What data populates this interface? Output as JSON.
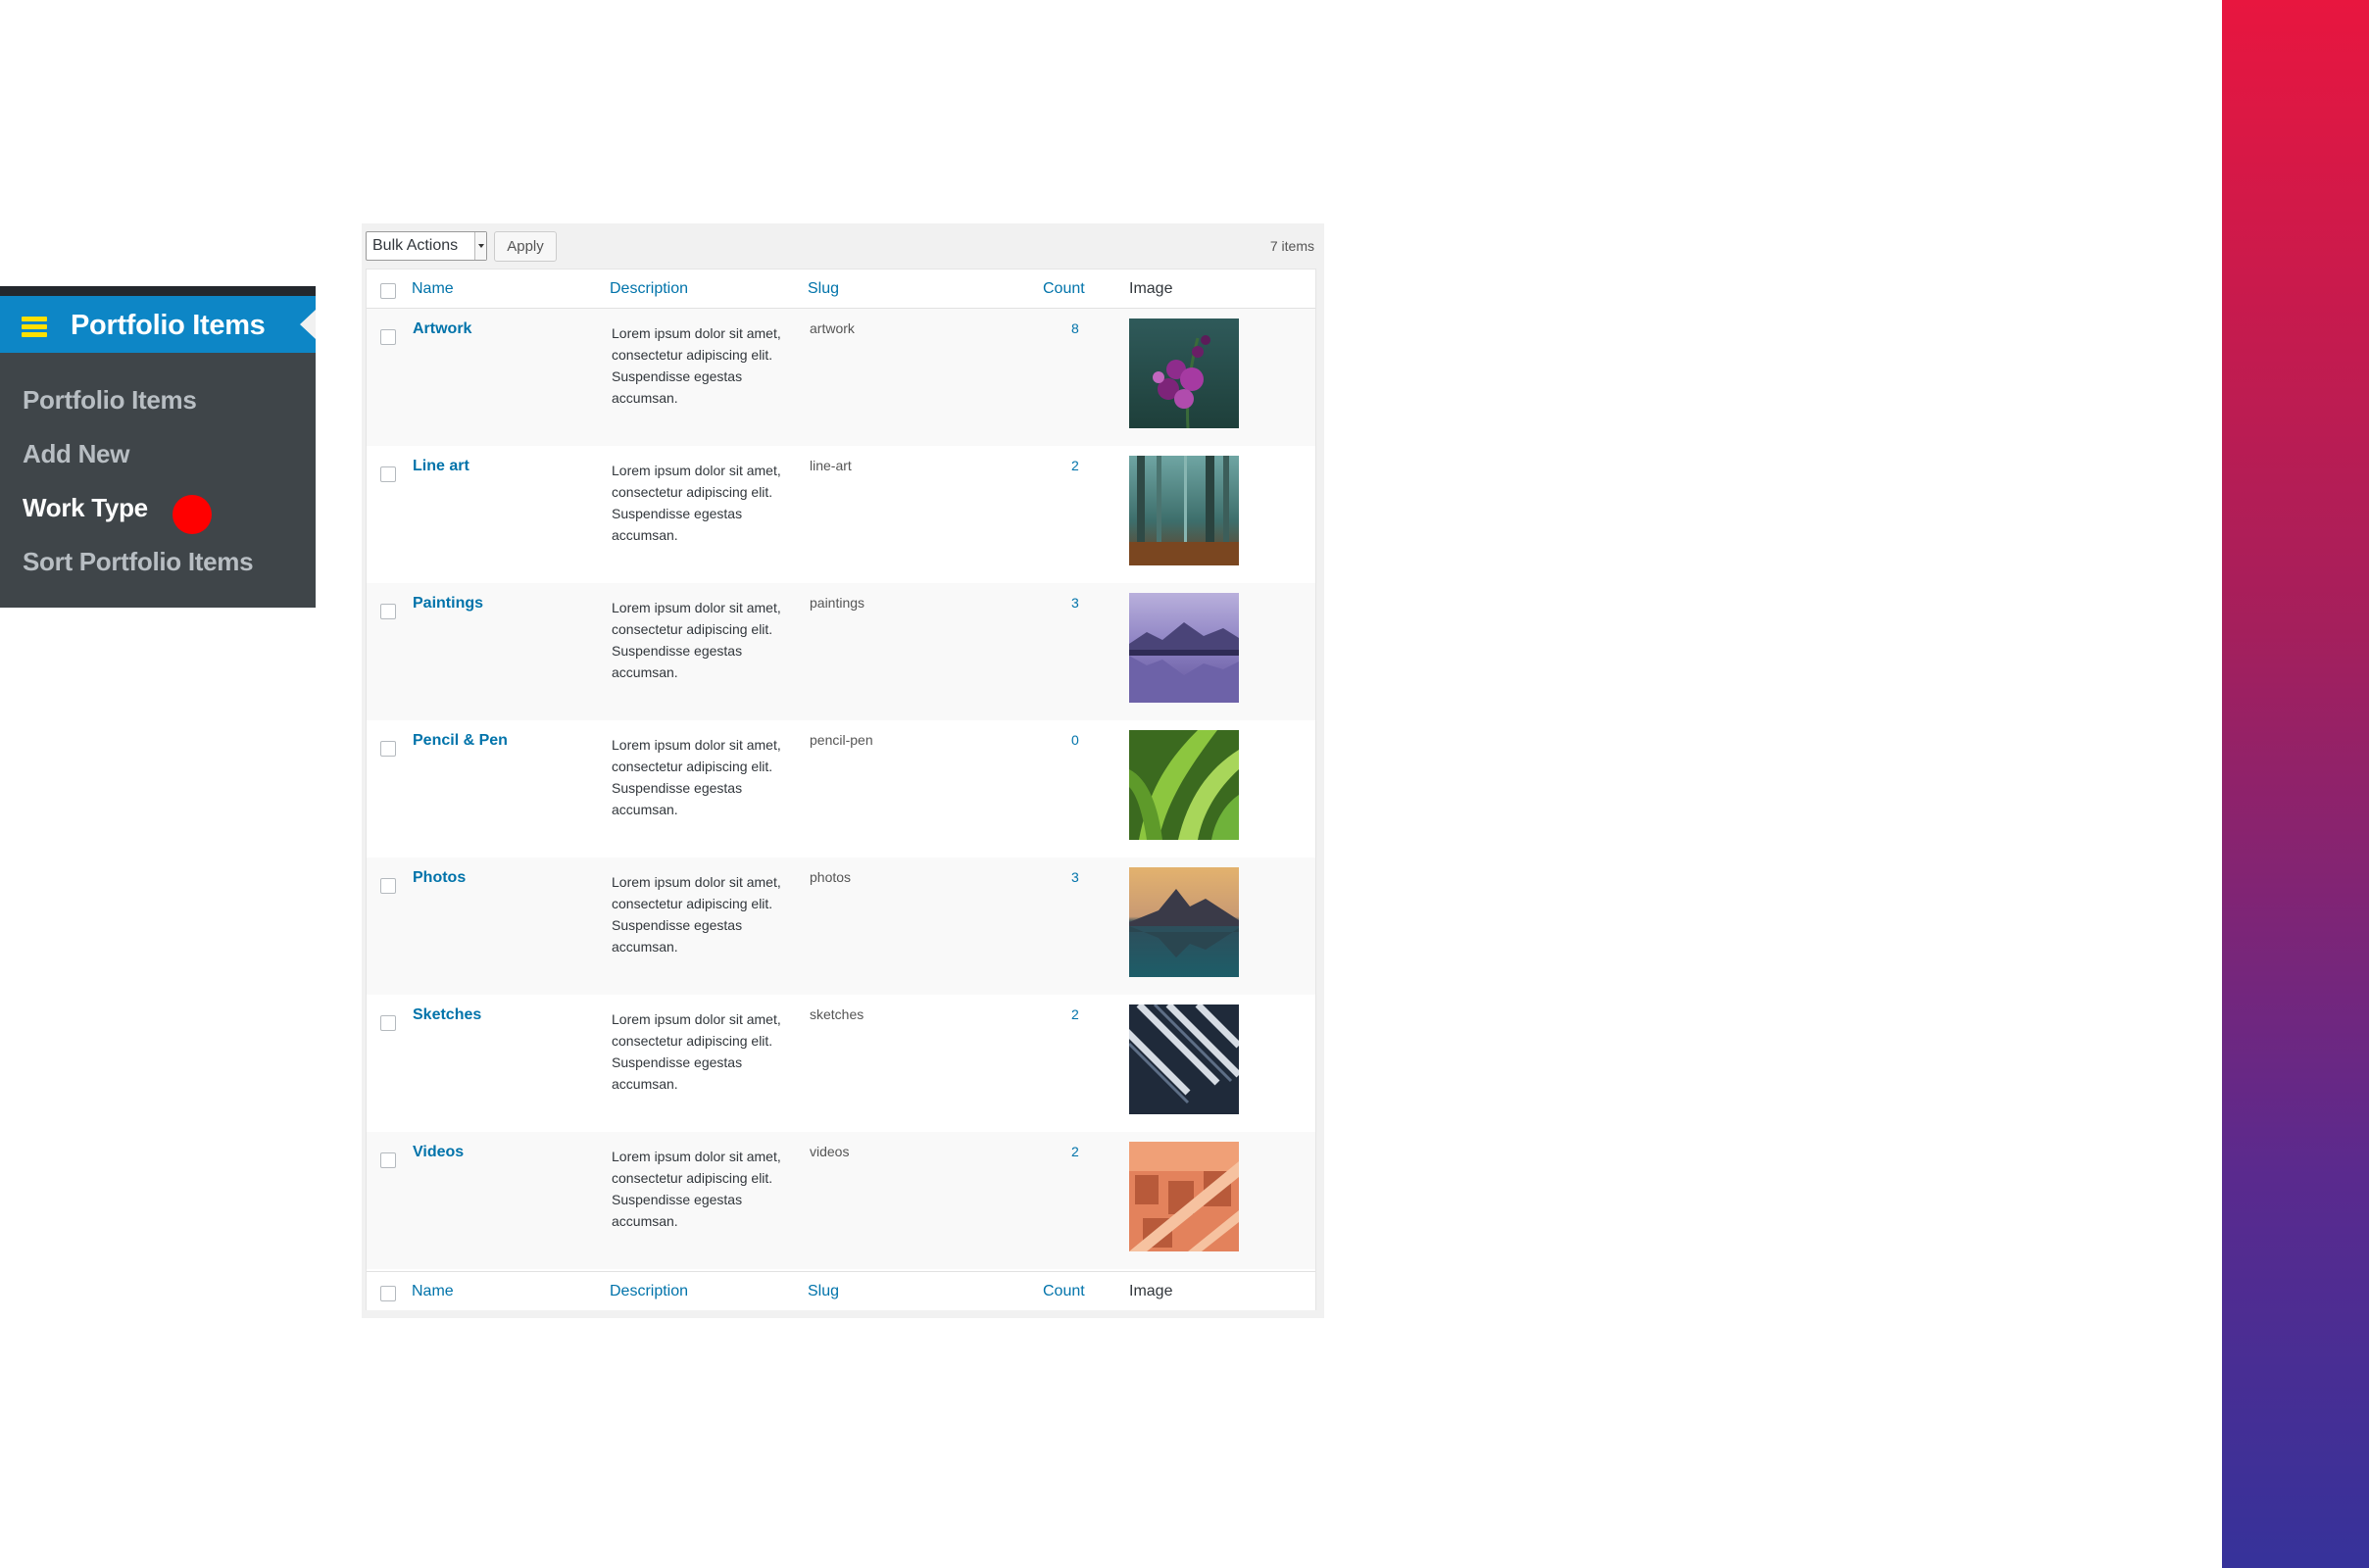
{
  "colors": {
    "menu_bg": "#3f4549",
    "menu_active": "#0d86c6",
    "hamburger": "#ffe000",
    "indicator": "#ff0000",
    "link": "#0073aa"
  },
  "admin_menu": {
    "section_label": "Portfolio Items",
    "section_icon": "hamburger-icon",
    "items": [
      {
        "label": "Portfolio Items",
        "current": false
      },
      {
        "label": "Add New",
        "current": false
      },
      {
        "label": "Work Type",
        "current": true
      },
      {
        "label": "Sort Portfolio Items",
        "current": false
      }
    ]
  },
  "toolbar": {
    "bulk_actions_value": "Bulk Actions",
    "apply_label": "Apply",
    "items_count": "7 items"
  },
  "columns": {
    "name": "Name",
    "description": "Description",
    "slug": "Slug",
    "count": "Count",
    "image": "Image"
  },
  "rows": [
    {
      "name": "Artwork",
      "description": "Lorem ipsum dolor sit amet, consectetur adipiscing elit. Suspendisse egestas accumsan.",
      "slug": "artwork",
      "count": "8",
      "image": "purple-flower-thumbnail"
    },
    {
      "name": "Line art",
      "description": "Lorem ipsum dolor sit amet, consectetur adipiscing elit. Suspendisse egestas accumsan.",
      "slug": "line-art",
      "count": "2",
      "image": "misty-forest-thumbnail"
    },
    {
      "name": "Paintings",
      "description": "Lorem ipsum dolor sit amet, consectetur adipiscing elit. Suspendisse egestas accumsan.",
      "slug": "paintings",
      "count": "3",
      "image": "lake-mountains-thumbnail"
    },
    {
      "name": "Pencil & Pen",
      "description": "Lorem ipsum dolor sit amet, consectetur adipiscing elit. Suspendisse egestas accumsan.",
      "slug": "pencil-pen",
      "count": "0",
      "image": "green-leaves-thumbnail"
    },
    {
      "name": "Photos",
      "description": "Lorem ipsum dolor sit amet, consectetur adipiscing elit. Suspendisse egestas accumsan.",
      "slug": "photos",
      "count": "3",
      "image": "mountain-reflection-thumbnail"
    },
    {
      "name": "Sketches",
      "description": "Lorem ipsum dolor sit amet, consectetur adipiscing elit. Suspendisse egestas accumsan.",
      "slug": "sketches",
      "count": "2",
      "image": "architecture-thumbnail"
    },
    {
      "name": "Videos",
      "description": "Lorem ipsum dolor sit amet, consectetur adipiscing elit. Suspendisse egestas accumsan.",
      "slug": "videos",
      "count": "2",
      "image": "orange-building-thumbnail"
    }
  ]
}
